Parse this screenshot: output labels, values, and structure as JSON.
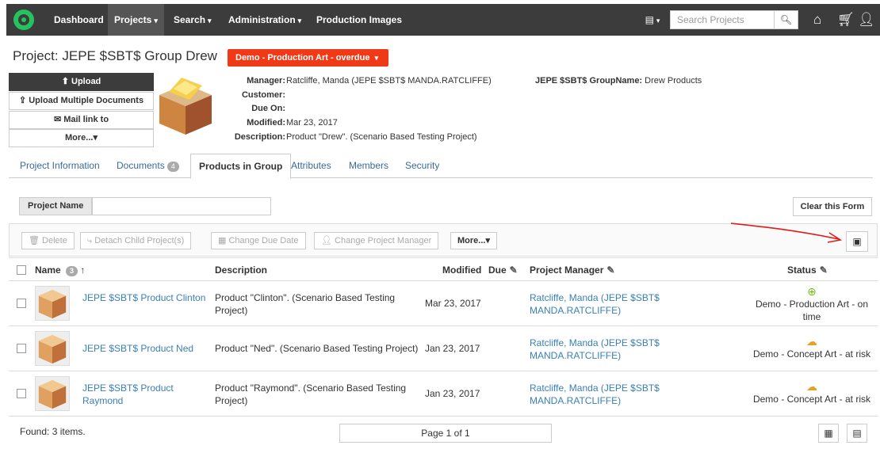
{
  "nav": {
    "items": [
      {
        "label": "Dashboard"
      },
      {
        "label": "Projects",
        "caret": "⌄"
      },
      {
        "label": "Search",
        "caret": "⌄"
      },
      {
        "label": "Administration",
        "caret": "⌄"
      },
      {
        "label": "Production Images"
      }
    ],
    "search_placeholder": "Search Projects"
  },
  "project": {
    "title_prefix": "Project:",
    "title_name": "JEPE $SBT$ Group Drew",
    "status_badge": "Demo - Production Art - overdue",
    "actions": [
      {
        "label": "Upload",
        "icon": "upload-icon"
      },
      {
        "label": "Upload Multiple Documents",
        "icon": "upload-multiple-icon"
      },
      {
        "label": "Mail link to",
        "icon": "mail-icon"
      },
      {
        "label": "More...▾"
      }
    ],
    "meta": {
      "manager_label": "Manager:",
      "manager_value": "Ratcliffe, Manda (JEPE $SBT$ MANDA.RATCLIFFE)",
      "customer_label": "Customer:",
      "customer_value": "",
      "due_label": "Due On:",
      "due_value": "",
      "modified_label": "Modified:",
      "modified_value": "Mar 23, 2017",
      "description_label": "Description:",
      "description_value": "Product \"Drew\". (Scenario Based Testing Project)",
      "groupname_label": "JEPE $SBT$ GroupName:",
      "groupname_value": "Drew Products"
    }
  },
  "tabs": [
    {
      "label": "Project Information"
    },
    {
      "label": "Documents",
      "count": "4"
    },
    {
      "label": "Products in Group"
    },
    {
      "label": "Attributes"
    },
    {
      "label": "Members"
    },
    {
      "label": "Security"
    }
  ],
  "filter": {
    "label": "Project Name",
    "value": "",
    "clear_label": "Clear this Form"
  },
  "toolbar": {
    "delete": "Delete",
    "detach": "Detach Child Project(s)",
    "change_due": "Change Due Date",
    "change_pm": "Change Project Manager",
    "more": "More...▾"
  },
  "table": {
    "headers": {
      "name": "Name",
      "name_count": "3",
      "description": "Description",
      "modified": "Modified",
      "due": "Due",
      "pm": "Project Manager",
      "status": "Status"
    },
    "rows": [
      {
        "name": "JEPE $SBT$ Product Clinton",
        "description": "Product \"Clinton\". (Scenario Based Testing Project)",
        "modified": "Mar 23, 2017",
        "pm": "Ratcliffe, Manda (JEPE $SBT$ MANDA.RATCLIFFE)",
        "status": "Demo - Production Art - on time",
        "status_color": "#7cb518"
      },
      {
        "name": "JEPE $SBT$ Product Ned",
        "description": "Product \"Ned\". (Scenario Based Testing Project)",
        "modified": "Jan 23, 2017",
        "pm": "Ratcliffe, Manda (JEPE $SBT$ MANDA.RATCLIFFE)",
        "status": "Demo - Concept Art - at risk",
        "status_color": "#e8a020"
      },
      {
        "name": "JEPE $SBT$ Product Raymond",
        "description": "Product \"Raymond\". (Scenario Based Testing Project)",
        "modified": "Jan 23, 2017",
        "pm": "Ratcliffe, Manda (JEPE $SBT$ MANDA.RATCLIFFE)",
        "status": "Demo - Concept Art - at risk",
        "status_color": "#e8a020"
      }
    ]
  },
  "footer": {
    "found": "Found: 3 items.",
    "pager": "Page 1 of 1"
  },
  "colors": {
    "topbar": "#3c3c3c",
    "accent_green": "#24c35d",
    "badge_red": "#f03a17",
    "link": "#3a7fb5"
  }
}
